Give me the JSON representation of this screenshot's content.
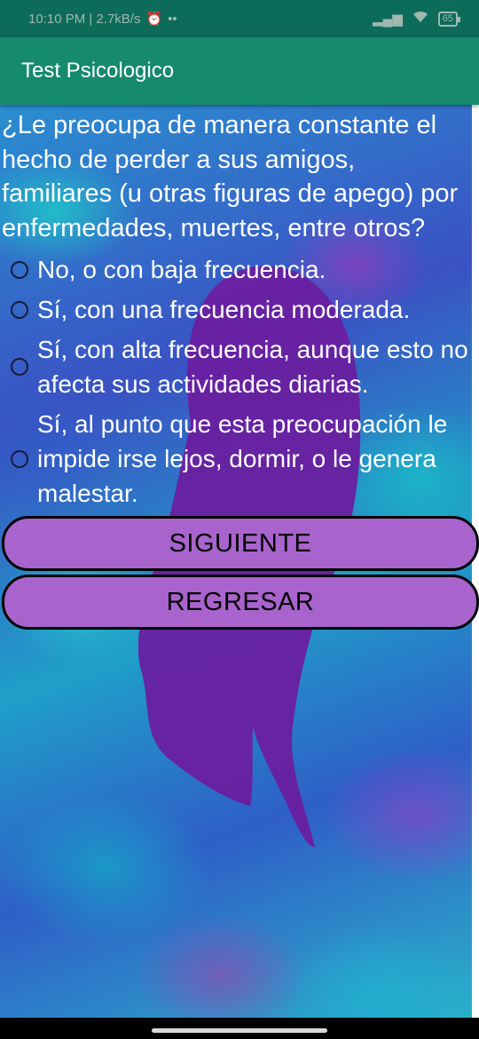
{
  "status_bar": {
    "time_speed": "10:10 PM | 2.7kB/s",
    "extra": "••",
    "battery": "65"
  },
  "app_bar": {
    "title": "Test Psicologico"
  },
  "question": {
    "text": "¿Le preocupa de manera constante el hecho de perder a sus amigos, familiares (u otras figuras de apego) por enfermedades, muertes, entre otros?"
  },
  "options": [
    {
      "label": "No, o con baja frecuencia."
    },
    {
      "label": "Sí, con una frecuencia moderada."
    },
    {
      "label": "Sí, con alta frecuencia, aunque esto no afecta sus actividades diarias."
    },
    {
      "label": "Sí, al punto que esta preocupación le impide irse lejos, dormir, o le genera malestar."
    }
  ],
  "buttons": {
    "next_label": "SIGUIENTE",
    "back_label": "REGRESAR"
  },
  "colors": {
    "status_bar": "#0d6b5a",
    "app_bar": "#168a6e",
    "button_fill": "#a864cc",
    "shape": "#6a1fa0"
  }
}
